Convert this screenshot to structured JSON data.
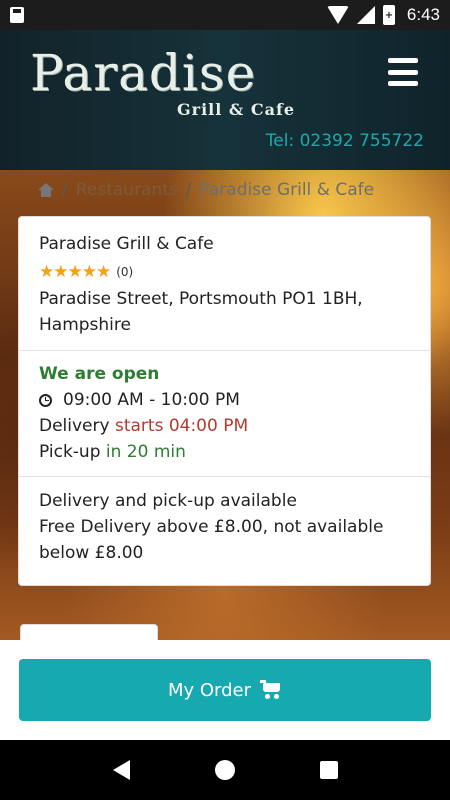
{
  "status_bar": {
    "time": "6:43",
    "battery_level": "+"
  },
  "header": {
    "logo_main": "Paradise",
    "logo_sub": "Grill & Cafe",
    "phone": "Tel: 02392 755722"
  },
  "breadcrumb": {
    "separator": "/",
    "items": [
      "Restaurants",
      "Paradise Grill & Cafe"
    ]
  },
  "restaurant": {
    "name": "Paradise Grill & Cafe",
    "stars": "★★★★★",
    "rating_count": "(0)",
    "address": "Paradise Street, Portsmouth PO1 1BH, Hampshire"
  },
  "hours": {
    "status": "We are open",
    "time_range": "09:00 AM - 10:00 PM",
    "delivery_prefix": "Delivery ",
    "delivery_value": "starts 04:00 PM",
    "pickup_prefix": "Pick-up ",
    "pickup_value": "in 20 min"
  },
  "services": {
    "availability": "Delivery and pick-up available",
    "free_delivery": "Free Delivery above £8.00, not available below £8.00"
  },
  "footer": {
    "order_button": "My Order"
  },
  "colors": {
    "accent": "#17a9b0",
    "open_green": "#2e7d32",
    "delivery_red": "#b23a2e",
    "star": "#f2a21b"
  }
}
